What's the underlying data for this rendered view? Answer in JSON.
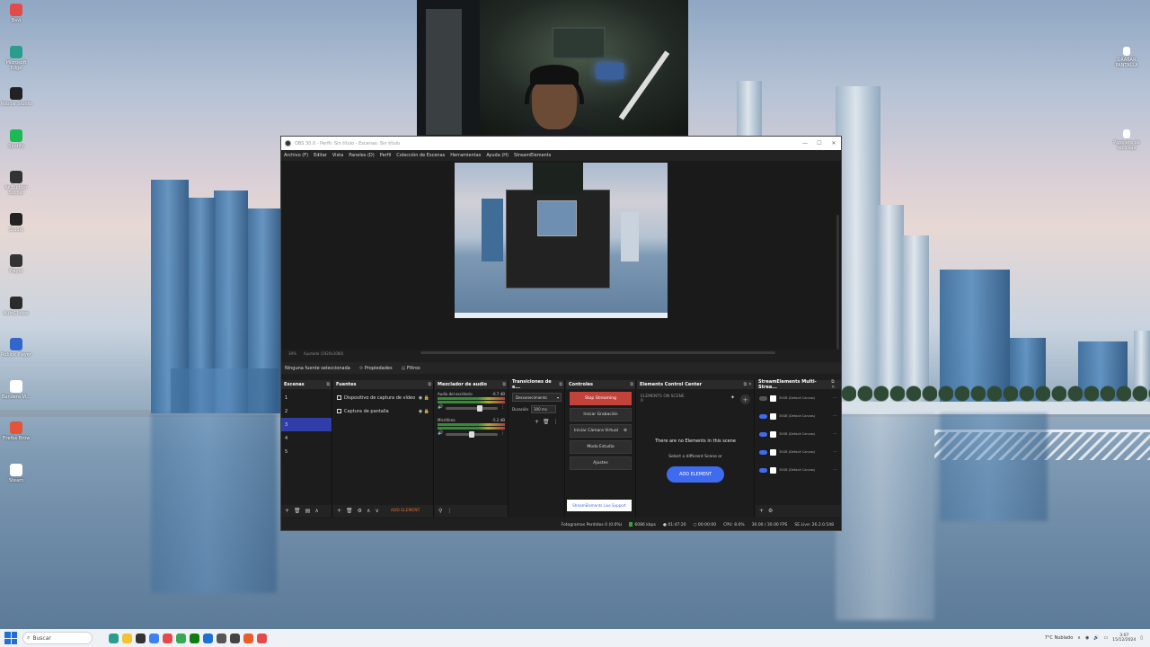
{
  "desktop": {
    "icons_left": [
      {
        "label": "Bavi",
        "color": "#e34b4b"
      },
      {
        "label": "Microsoft Edge",
        "color": "#2a9d8f"
      },
      {
        "label": "Roblox Studio",
        "color": "#222222"
      },
      {
        "label": "Spotify",
        "color": "#1db954"
      },
      {
        "label": "Ar Builder Soccer",
        "color": "#333333"
      },
      {
        "label": "Studio",
        "color": "#222222"
      },
      {
        "label": "Player",
        "color": "#333333"
      },
      {
        "label": "AutoClicker",
        "color": "#2b2b2b"
      },
      {
        "label": "Roblox Player",
        "color": "#3366cc"
      },
      {
        "label": "Bandera Vi...",
        "color": "#ffffff"
      },
      {
        "label": "Firefox Brow",
        "color": "#e3543b"
      },
      {
        "label": "Steam",
        "color": "#ffffff"
      }
    ],
    "icons_right": [
      {
        "label": "GRABAR PANTALLA",
        "color": "#ffffff"
      },
      {
        "label": "Papelera de reciclaje",
        "color": "#ffffff"
      }
    ]
  },
  "obs": {
    "title": "OBS 30.0 - Perfil: Sin título - Escenas: Sin título",
    "menu": [
      "Archivo (F)",
      "Editar",
      "Vista",
      "Paneles (D)",
      "Perfil",
      "Colección de Escenas",
      "Herramientas",
      "Ayuda (H)",
      "StreamElements"
    ],
    "zoom_text": "39%",
    "canvas_text": "Ajustado (1920x1080)",
    "source_bar": {
      "none_selected": "Ninguna fuente seleccionada",
      "properties": "Propiedades",
      "filters": "Filtros"
    },
    "scenes": {
      "title": "Escenas",
      "items": [
        "1",
        "2",
        "3",
        "4",
        "5"
      ],
      "selected_index": 2
    },
    "sources": {
      "title": "Fuentes",
      "items": [
        {
          "label": "Dispositivo de captura de vídeo"
        },
        {
          "label": "Captura de pantalla"
        }
      ]
    },
    "mixer": {
      "title": "Mezclador de audio",
      "channels": [
        {
          "name": "Audio del escritorio",
          "db": "-6.7 dB",
          "level": 0.6
        },
        {
          "name": "Micrófono",
          "db": "-5.2 dB",
          "level": 0.45
        }
      ]
    },
    "transitions": {
      "title": "Transiciones de e...",
      "selected": "Desvanecimiento",
      "duration_label": "Duración",
      "duration_value": "300 ms"
    },
    "controls": {
      "title": "Controles",
      "buttons": [
        "Stop Streaming",
        "Iniciar Grabación",
        "Iniciar Cámara Virtual",
        "Modo Estudio",
        "Ajustes"
      ]
    },
    "ecc": {
      "title": "Elements Control Center",
      "header": "ELEMENTS ON SCENE",
      "count": "0",
      "empty_title": "There are no Elements in this scene",
      "empty_sub": "Select a different Scene or",
      "add_button": "ADD ELEMENT",
      "support": "StreamElements Live Support"
    },
    "multistream": {
      "title": "StreamElements Multi-Strea...",
      "rows": [
        {
          "text": "30GB (Default Canvas)",
          "on": false
        },
        {
          "text": "30GB (Default Canvas)",
          "on": true
        },
        {
          "text": "30GB (Default Canvas)",
          "on": true
        },
        {
          "text": "30GB (Default Canvas)",
          "on": true
        },
        {
          "text": "30GB (Default Canvas)",
          "on": true
        }
      ]
    },
    "add_element_footer": "ADD ELEMENT",
    "status": {
      "dropped": "Fotogramas Perdidos 0 (0.0%)",
      "bitrate": "6086 kbps",
      "live_time": "01:47:20",
      "rec_time": "00:00:00",
      "cpu": "CPU: 8.0%",
      "fps": "30.00 / 30.00 FPS",
      "version": "SE.Live: 26.2.0.548"
    }
  },
  "taskbar": {
    "search_placeholder": "Buscar",
    "pins": [
      {
        "name": "edge",
        "color": "#2a9d8f"
      },
      {
        "name": "files",
        "color": "#f2c230"
      },
      {
        "name": "obs",
        "color": "#333333"
      },
      {
        "name": "store",
        "color": "#3b82f6"
      },
      {
        "name": "chrome",
        "color": "#e34b4b"
      },
      {
        "name": "chrome-green",
        "color": "#34a853"
      },
      {
        "name": "xbox",
        "color": "#107c10"
      },
      {
        "name": "ie",
        "color": "#1f6fd6"
      },
      {
        "name": "clock",
        "color": "#555555"
      },
      {
        "name": "obs2",
        "color": "#444444"
      },
      {
        "name": "brave",
        "color": "#e85d2a"
      },
      {
        "name": "firefox",
        "color": "#e34b4b"
      }
    ],
    "weather": "7°C Nublado",
    "time": "3:07",
    "date": "15/12/2024"
  }
}
